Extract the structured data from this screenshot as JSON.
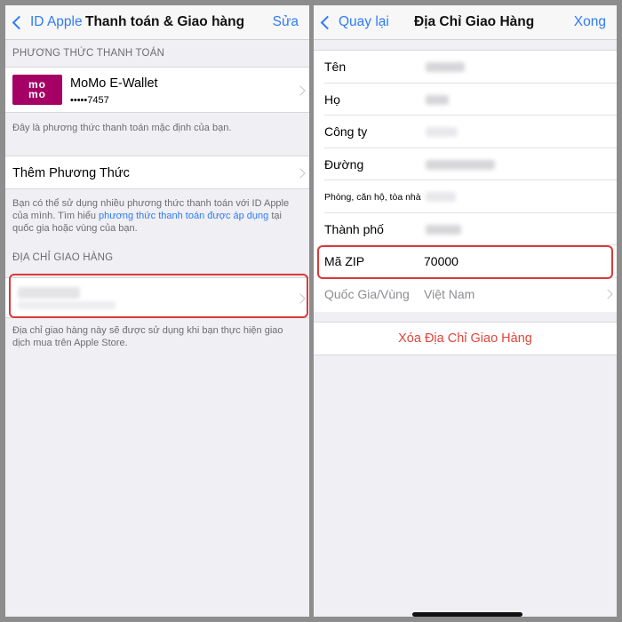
{
  "left": {
    "nav": {
      "back_label": "ID Apple",
      "title": "Thanh toán & Giao hàng",
      "action_label": "Sửa"
    },
    "payment_section_header": "PHƯƠNG THỨC THANH TOÁN",
    "payment_method": {
      "logo_top": "mo",
      "logo_bottom": "mo",
      "name": "MoMo E-Wallet",
      "number": "•••••7457"
    },
    "default_note": "Đây là phương thức thanh toán mặc định của bạn.",
    "add_method_label": "Thêm Phương Thức",
    "multi_note_pre": "Bạn có thể sử dụng nhiều phương thức thanh toán với ID Apple của mình. Tìm hiểu ",
    "multi_note_link": "phương thức thanh toán được áp dụng",
    "multi_note_post": " tại quốc gia hoặc vùng của bạn.",
    "shipping_section_header": "ĐỊA CHỈ GIAO HÀNG",
    "shipping_note": "Địa chỉ giao hàng này sẽ được sử dụng khi bạn thực hiện giao dịch mua trên Apple Store."
  },
  "right": {
    "nav": {
      "back_label": "Quay lại",
      "title": "Địa Chỉ Giao Hàng",
      "action_label": "Xong"
    },
    "fields": [
      {
        "label": "Tên",
        "value": ""
      },
      {
        "label": "Họ",
        "value": ""
      },
      {
        "label": "Công ty",
        "value": ""
      },
      {
        "label": "Đường",
        "value": ""
      },
      {
        "label": "Phòng, căn hộ, tòa nhà",
        "value": ""
      },
      {
        "label": "Thành phố",
        "value": ""
      },
      {
        "label": "Mã ZIP",
        "value": "70000"
      },
      {
        "label": "Quốc Gia/Vùng",
        "value": "Việt Nam"
      }
    ],
    "delete_label": "Xóa Địa Chỉ Giao Hàng"
  },
  "colors": {
    "accent": "#2f7cf6",
    "momo": "#a50064",
    "highlight": "#d93a3a",
    "destructive": "#e0463a"
  }
}
